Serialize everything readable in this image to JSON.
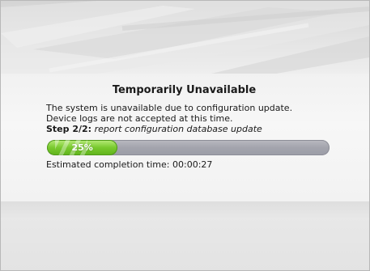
{
  "dialog": {
    "title": "Temporarily Unavailable",
    "line1": "The system is unavailable due to configuration update.",
    "line2": "Device logs are not accepted at this time.",
    "step_label": "Step 2/2:",
    "step_text": "report configuration database update"
  },
  "progress": {
    "value": 0.25,
    "label": "25%",
    "fill_color": "#79c92e",
    "track_color": "#a3a4ad"
  },
  "eta": {
    "text": "Estimated completion time: 00:00:27"
  }
}
